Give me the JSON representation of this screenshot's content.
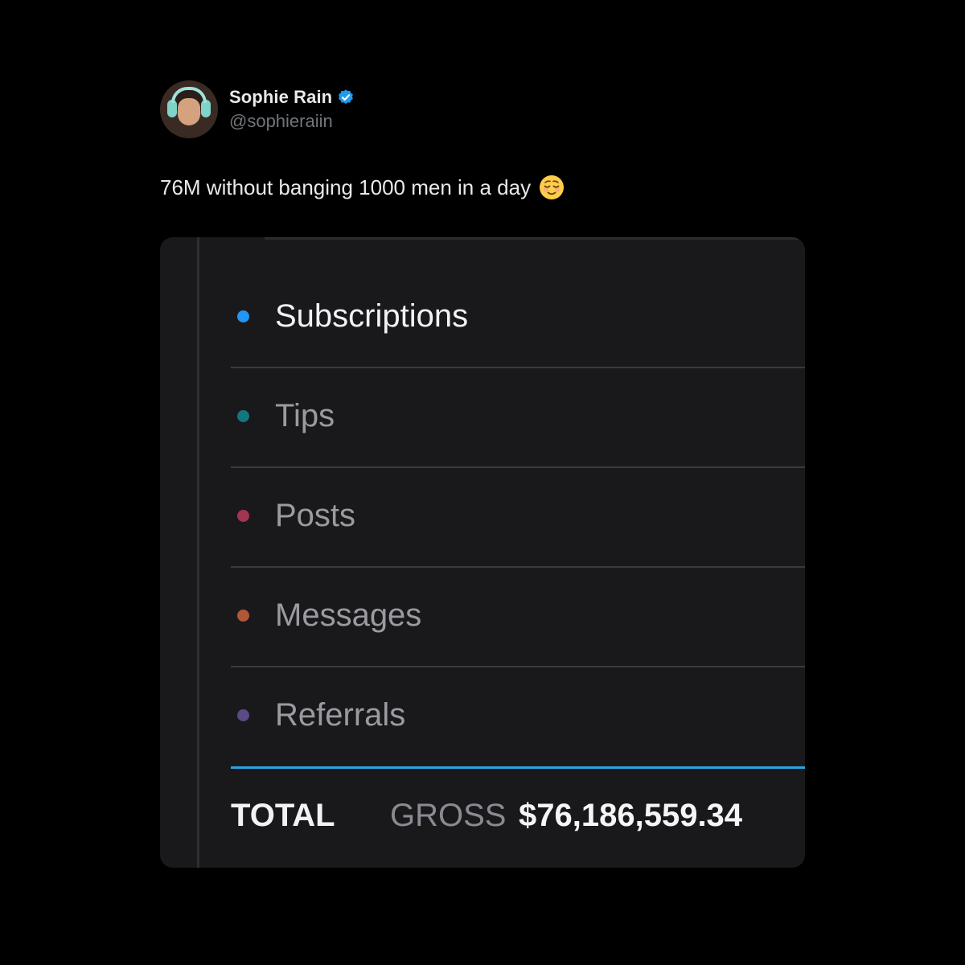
{
  "post": {
    "author": {
      "display_name": "Sophie Rain",
      "handle": "@sophieraiin",
      "verified": true,
      "verified_icon": "verified-badge-icon",
      "verified_color": "#1d9bf0"
    },
    "text": "76M without banging 1000 men in a day",
    "emoji": "relieved-face-emoji"
  },
  "earnings_card": {
    "rows": [
      {
        "label": "Subscriptions",
        "dot_color": "#2196f3",
        "active": true
      },
      {
        "label": "Tips",
        "dot_color": "#14767e",
        "active": false
      },
      {
        "label": "Posts",
        "dot_color": "#a23650",
        "active": false
      },
      {
        "label": "Messages",
        "dot_color": "#b25638",
        "active": false
      },
      {
        "label": "Referrals",
        "dot_color": "#5a4a86",
        "active": false
      }
    ],
    "total_label": "TOTAL",
    "gross_label": "GROSS",
    "total_value": "$76,186,559.34",
    "accent_color": "#26a6e0"
  }
}
